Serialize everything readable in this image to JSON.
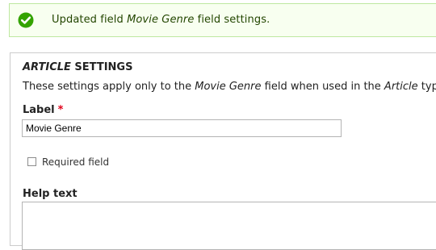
{
  "status_message": {
    "prefix": "Updated field ",
    "field_name": "Movie Genre",
    "suffix": " field settings.",
    "icon": "checkmark-circle-icon",
    "icon_color": "#34a300",
    "background": "#f8fff0",
    "border": "#bee8a0"
  },
  "settings": {
    "legend_type": "Article",
    "legend_suffix": " Settings",
    "description": {
      "part1": "These settings apply only to the ",
      "field_name": "Movie Genre",
      "part2": " field when used in the ",
      "type_name": "Article",
      "part3": " type."
    },
    "label_field": {
      "label": "Label",
      "required_marker": "*",
      "value": "Movie Genre"
    },
    "required_checkbox": {
      "label": "Required field",
      "checked": false
    },
    "help_text": {
      "label": "Help text",
      "value": ""
    }
  }
}
